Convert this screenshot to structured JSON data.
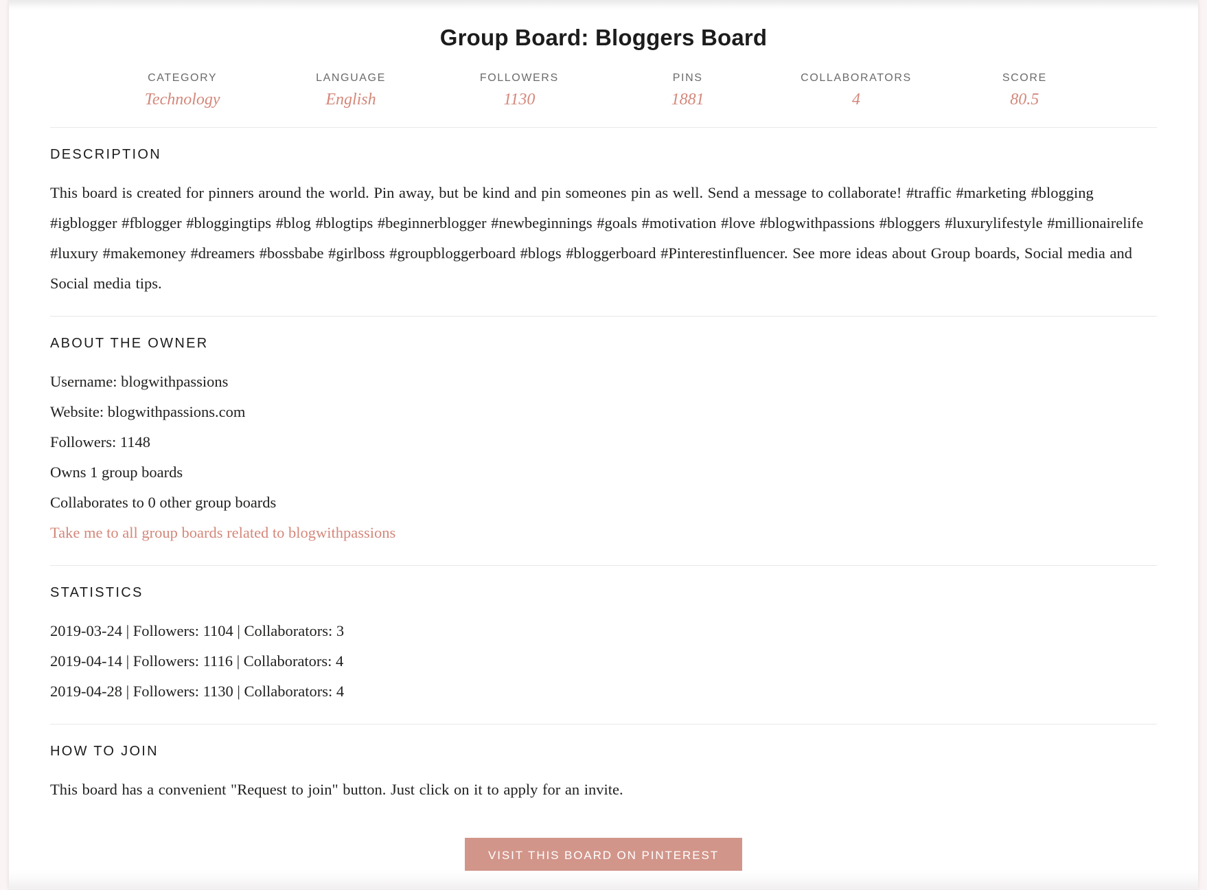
{
  "page": {
    "title": "Group Board: Bloggers Board",
    "accent_color": "#d4877a",
    "button_color": "#d2958a",
    "background_color": "#faf5f4"
  },
  "stats_strip": [
    {
      "label": "CATEGORY",
      "value": "Technology"
    },
    {
      "label": "LANGUAGE",
      "value": "English"
    },
    {
      "label": "FOLLOWERS",
      "value": "1130"
    },
    {
      "label": "PINS",
      "value": "1881"
    },
    {
      "label": "COLLABORATORS",
      "value": "4"
    },
    {
      "label": "SCORE",
      "value": "80.5"
    }
  ],
  "description": {
    "heading": "DESCRIPTION",
    "text": "This board is created for pinners around the world. Pin away, but be kind and pin someones pin as well. Send a message to collaborate! #traffic #marketing #blogging #igblogger #fblogger #bloggingtips #blog #blogtips #beginnerblogger #newbeginnings #goals #motivation #love #blogwithpassions #bloggers #luxurylifestyle #millionairelife #luxury #makemoney #dreamers #bossbabe #girlboss #groupbloggerboard #blogs #bloggerboard #Pinterestinfluencer. See more ideas about Group boards, Social media and Social media tips."
  },
  "owner": {
    "heading": "ABOUT THE OWNER",
    "lines": [
      "Username: blogwithpassions",
      "Website: blogwithpassions.com",
      "Followers: 1148",
      "Owns 1 group boards",
      "Collaborates to 0 other group boards"
    ],
    "link_text": "Take me to all group boards related to blogwithpassions"
  },
  "statistics": {
    "heading": "STATISTICS",
    "rows": [
      "2019-03-24 | Followers: 1104 | Collaborators: 3",
      "2019-04-14 | Followers: 1116 | Collaborators: 4",
      "2019-04-28 | Followers: 1130 | Collaborators: 4"
    ]
  },
  "how_to_join": {
    "heading": "HOW TO JOIN",
    "text": "This board has a convenient \"Request to join\" button. Just click on it to apply for an invite."
  },
  "cta": {
    "label": "VISIT THIS BOARD ON PINTEREST"
  }
}
